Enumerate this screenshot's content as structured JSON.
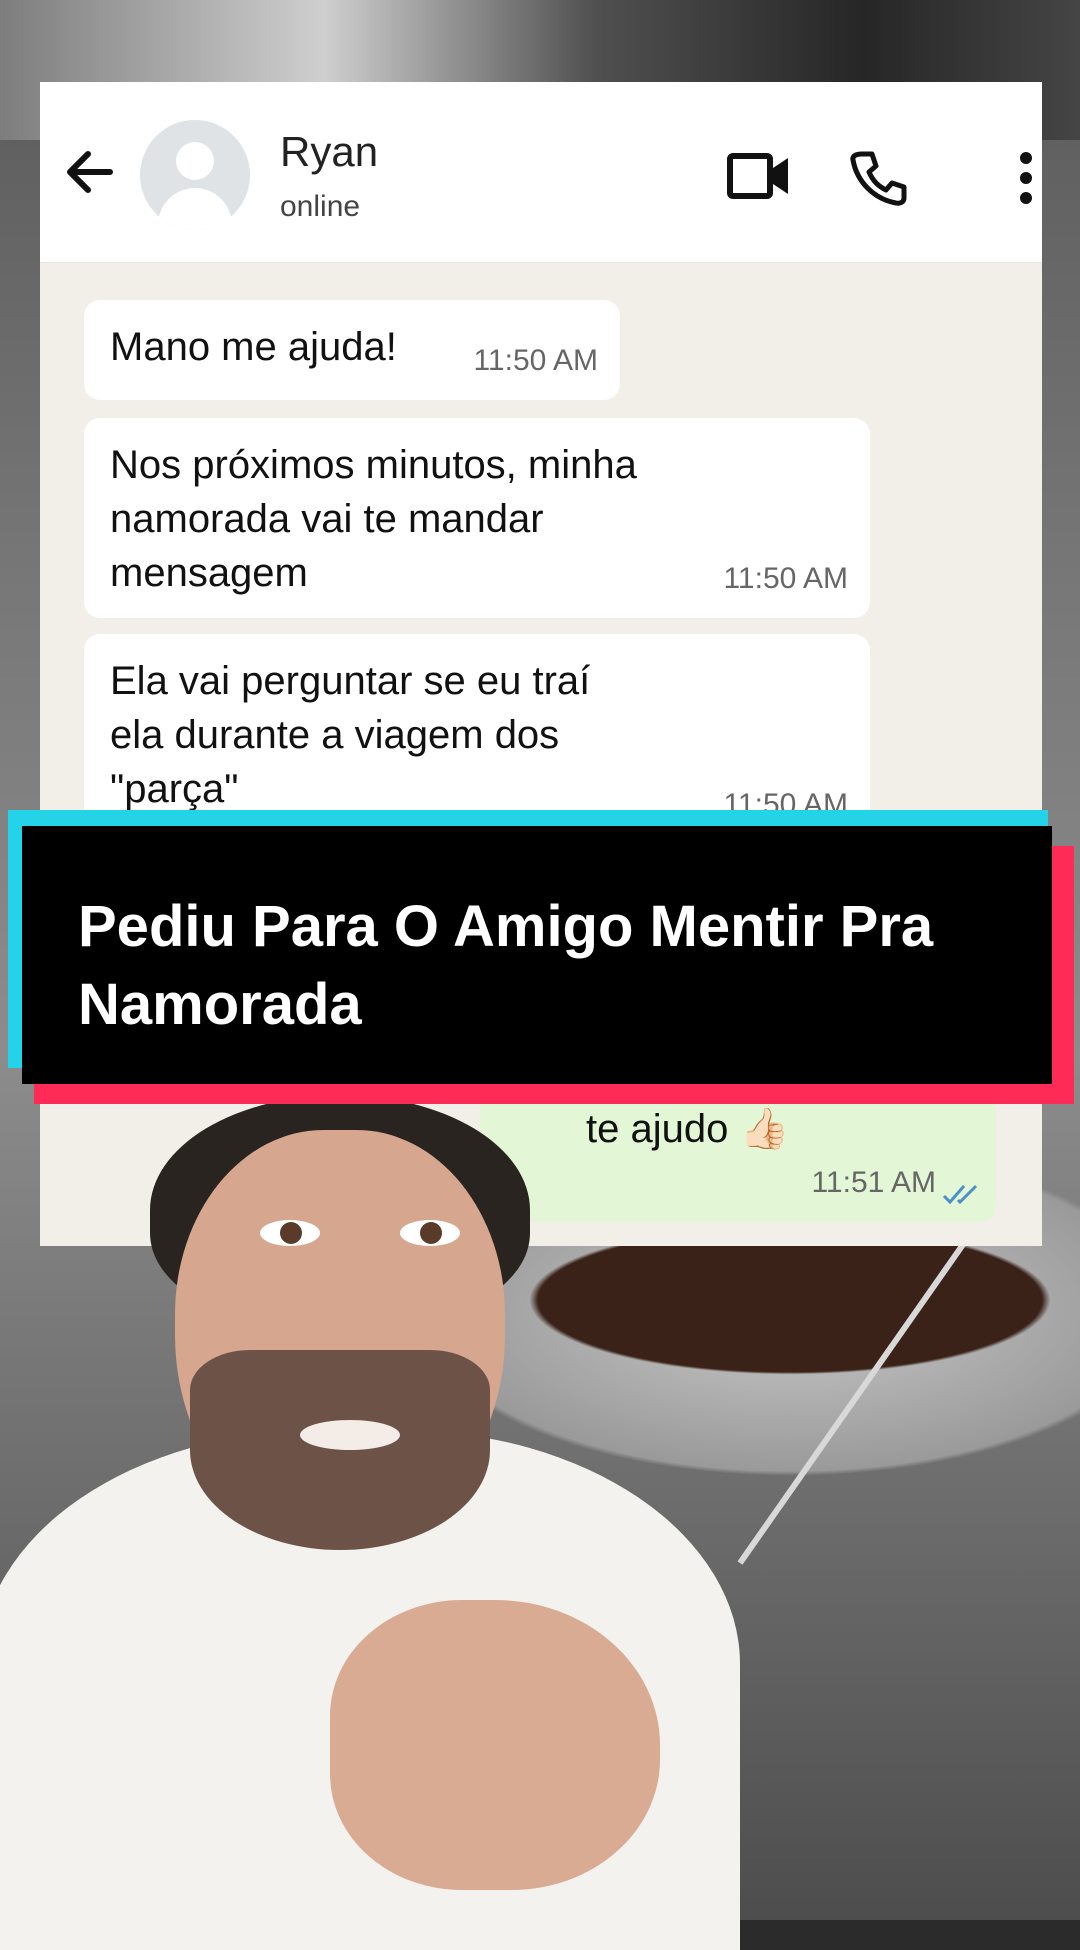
{
  "chat": {
    "contact_name": "Ryan",
    "contact_status": "online",
    "messages": [
      {
        "text": "Mano me ajuda!",
        "time": "11:50 AM"
      },
      {
        "text": "Nos próximos minutos, minha\nnamorada vai te mandar\nmensagem",
        "time": "11:50 AM"
      },
      {
        "text": "Ela vai perguntar se eu traí\nela durante a viagem dos\n\"parça\"",
        "time": "11:50 AM"
      }
    ],
    "reply": {
      "text": "te ajudo 👍🏻",
      "time": "11:51 AM"
    }
  },
  "banner": {
    "title": "Pediu Para O Amigo Mentir Pra Namorada"
  },
  "colors": {
    "banner_cyan": "#25d3e8",
    "banner_red": "#fd2b56",
    "read_ticks": "#4a90c9"
  },
  "icons": [
    "back-arrow-icon",
    "video-call-icon",
    "phone-icon",
    "more-vert-icon",
    "double-check-icon"
  ]
}
